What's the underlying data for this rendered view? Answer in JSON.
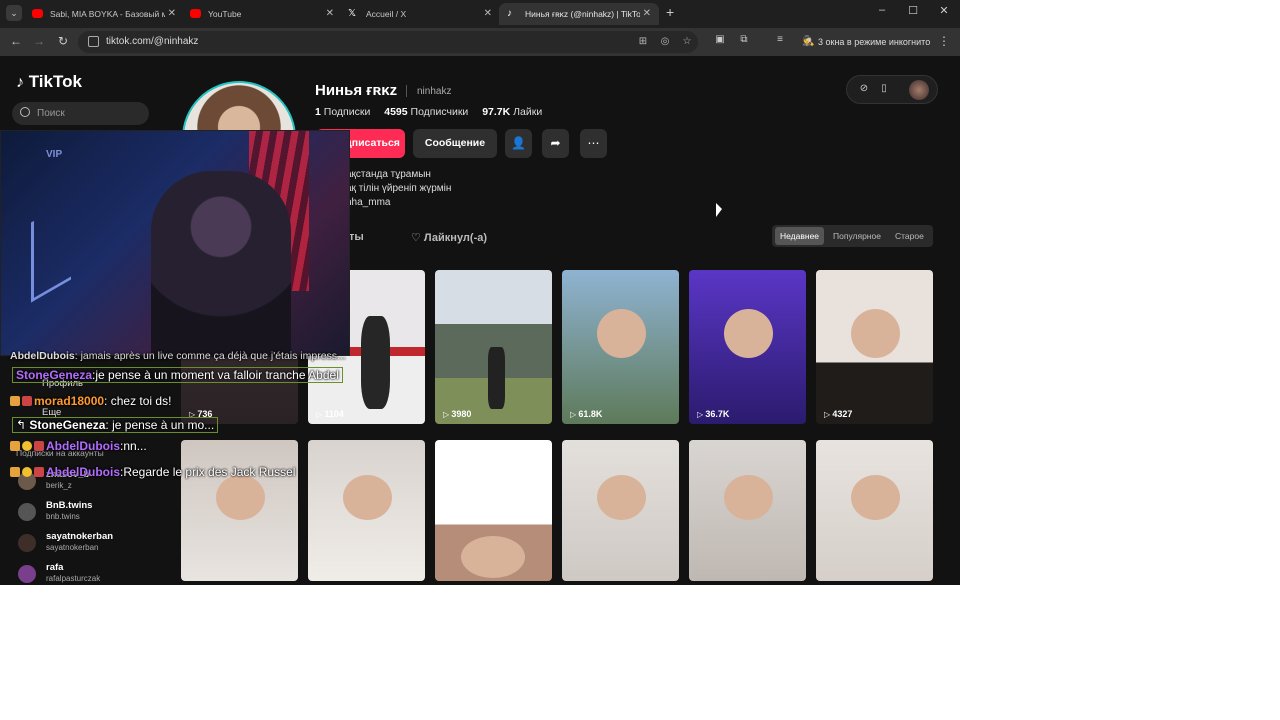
{
  "browser": {
    "tabs": [
      {
        "title": "Sabi, MIA BOYKA - Базовый м",
        "icon_color": "#ff0000",
        "active": false
      },
      {
        "title": "YouTube",
        "icon_color": "#ff0000",
        "active": false
      },
      {
        "title": "Accueil / X",
        "icon_color": "#ffffff",
        "active": false
      },
      {
        "title": "Нинья ғʀᴋᴢ (@ninhakz) | TikTok",
        "icon_color": "#ffffff",
        "active": true
      }
    ],
    "new_tab": "+",
    "url": "tiktok.com/@ninhakz",
    "incognito_label": "3 окна в режиме инкогнито",
    "window_controls": [
      "–",
      "☐",
      "✕"
    ]
  },
  "sidebar": {
    "logo": "TikTok",
    "search_placeholder": "Поиск",
    "profile_label": "Профиль",
    "more_label": "Еще",
    "following_header": "Подписки на аккаунты",
    "accounts": [
      {
        "name": "zhasov_b",
        "handle": "berik_z"
      },
      {
        "name": "BnB.twins",
        "handle": "bnb.twins"
      },
      {
        "name": "sayatnokerban",
        "handle": "sayatnokerban"
      },
      {
        "name": "rafa",
        "handle": "rafalpasturczak"
      }
    ]
  },
  "profile": {
    "display_name": "Нинья ғʀᴋᴢ",
    "username": "ninhakz",
    "following_count": "1",
    "following_label": "Подписки",
    "followers_count": "4595",
    "followers_label": "Подписчики",
    "likes_count": "97.7K",
    "likes_label": "Лайки",
    "subscribe_label": "дписаться",
    "message_label": "Сообщение",
    "bio_lines": [
      "ақстанда тұрамын",
      "ақ тілін үйреніп жүрмін",
      "nha_mma"
    ],
    "tab_videos": "ты",
    "tab_liked": "Лайкнул(-а)",
    "sort_options": [
      "Недавнее",
      "Популярное",
      "Старое"
    ]
  },
  "videos": [
    {
      "views": "736"
    },
    {
      "views": "1104"
    },
    {
      "views": "3980"
    },
    {
      "views": "61.8K"
    },
    {
      "views": "36.7K"
    },
    {
      "views": "4327"
    },
    {
      "views": ""
    },
    {
      "views": ""
    },
    {
      "views": ""
    },
    {
      "views": ""
    },
    {
      "views": ""
    },
    {
      "views": ""
    }
  ],
  "stream_overlay": {
    "camera_sign": "VIP",
    "chat": [
      {
        "user": "AbdelDubois",
        "text": "jamais après un live comme ça déjà que j'étais impress...",
        "color": "#ffffff"
      },
      {
        "user": "StoneGeneza",
        "text": "je pense à un moment va falloir tranche Abdel",
        "color": "#b36cff"
      },
      {
        "user": "morad18000",
        "text": "chez toi ds!",
        "color": "#ff9b2e"
      },
      {
        "user": "StoneGeneza",
        "text": "je pense à un mo...",
        "color": "#ffffff"
      },
      {
        "user": "AbdelDubois",
        "text": "nn...",
        "color": "#b36cff"
      },
      {
        "user": "AbdelDubois",
        "text": "Regarde le prix des Jack Russel",
        "color": "#b36cff"
      }
    ]
  }
}
